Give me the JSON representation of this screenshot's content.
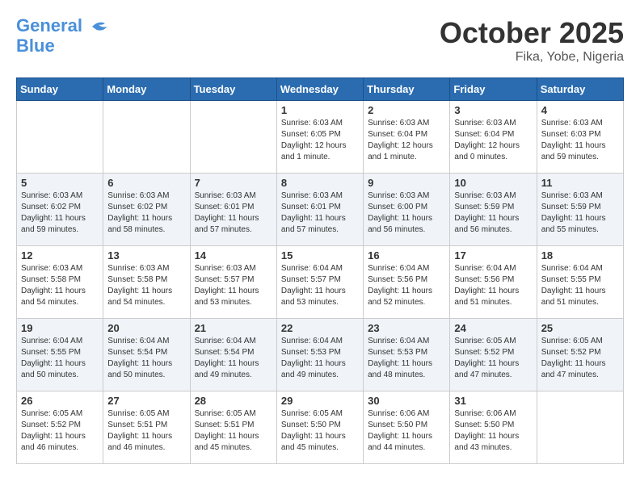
{
  "header": {
    "logo_line1": "General",
    "logo_line2": "Blue",
    "month": "October 2025",
    "location": "Fika, Yobe, Nigeria"
  },
  "days_of_week": [
    "Sunday",
    "Monday",
    "Tuesday",
    "Wednesday",
    "Thursday",
    "Friday",
    "Saturday"
  ],
  "weeks": [
    [
      {
        "num": "",
        "info": ""
      },
      {
        "num": "",
        "info": ""
      },
      {
        "num": "",
        "info": ""
      },
      {
        "num": "1",
        "info": "Sunrise: 6:03 AM\nSunset: 6:05 PM\nDaylight: 12 hours\nand 1 minute."
      },
      {
        "num": "2",
        "info": "Sunrise: 6:03 AM\nSunset: 6:04 PM\nDaylight: 12 hours\nand 1 minute."
      },
      {
        "num": "3",
        "info": "Sunrise: 6:03 AM\nSunset: 6:04 PM\nDaylight: 12 hours\nand 0 minutes."
      },
      {
        "num": "4",
        "info": "Sunrise: 6:03 AM\nSunset: 6:03 PM\nDaylight: 11 hours\nand 59 minutes."
      }
    ],
    [
      {
        "num": "5",
        "info": "Sunrise: 6:03 AM\nSunset: 6:02 PM\nDaylight: 11 hours\nand 59 minutes."
      },
      {
        "num": "6",
        "info": "Sunrise: 6:03 AM\nSunset: 6:02 PM\nDaylight: 11 hours\nand 58 minutes."
      },
      {
        "num": "7",
        "info": "Sunrise: 6:03 AM\nSunset: 6:01 PM\nDaylight: 11 hours\nand 57 minutes."
      },
      {
        "num": "8",
        "info": "Sunrise: 6:03 AM\nSunset: 6:01 PM\nDaylight: 11 hours\nand 57 minutes."
      },
      {
        "num": "9",
        "info": "Sunrise: 6:03 AM\nSunset: 6:00 PM\nDaylight: 11 hours\nand 56 minutes."
      },
      {
        "num": "10",
        "info": "Sunrise: 6:03 AM\nSunset: 5:59 PM\nDaylight: 11 hours\nand 56 minutes."
      },
      {
        "num": "11",
        "info": "Sunrise: 6:03 AM\nSunset: 5:59 PM\nDaylight: 11 hours\nand 55 minutes."
      }
    ],
    [
      {
        "num": "12",
        "info": "Sunrise: 6:03 AM\nSunset: 5:58 PM\nDaylight: 11 hours\nand 54 minutes."
      },
      {
        "num": "13",
        "info": "Sunrise: 6:03 AM\nSunset: 5:58 PM\nDaylight: 11 hours\nand 54 minutes."
      },
      {
        "num": "14",
        "info": "Sunrise: 6:03 AM\nSunset: 5:57 PM\nDaylight: 11 hours\nand 53 minutes."
      },
      {
        "num": "15",
        "info": "Sunrise: 6:04 AM\nSunset: 5:57 PM\nDaylight: 11 hours\nand 53 minutes."
      },
      {
        "num": "16",
        "info": "Sunrise: 6:04 AM\nSunset: 5:56 PM\nDaylight: 11 hours\nand 52 minutes."
      },
      {
        "num": "17",
        "info": "Sunrise: 6:04 AM\nSunset: 5:56 PM\nDaylight: 11 hours\nand 51 minutes."
      },
      {
        "num": "18",
        "info": "Sunrise: 6:04 AM\nSunset: 5:55 PM\nDaylight: 11 hours\nand 51 minutes."
      }
    ],
    [
      {
        "num": "19",
        "info": "Sunrise: 6:04 AM\nSunset: 5:55 PM\nDaylight: 11 hours\nand 50 minutes."
      },
      {
        "num": "20",
        "info": "Sunrise: 6:04 AM\nSunset: 5:54 PM\nDaylight: 11 hours\nand 50 minutes."
      },
      {
        "num": "21",
        "info": "Sunrise: 6:04 AM\nSunset: 5:54 PM\nDaylight: 11 hours\nand 49 minutes."
      },
      {
        "num": "22",
        "info": "Sunrise: 6:04 AM\nSunset: 5:53 PM\nDaylight: 11 hours\nand 49 minutes."
      },
      {
        "num": "23",
        "info": "Sunrise: 6:04 AM\nSunset: 5:53 PM\nDaylight: 11 hours\nand 48 minutes."
      },
      {
        "num": "24",
        "info": "Sunrise: 6:05 AM\nSunset: 5:52 PM\nDaylight: 11 hours\nand 47 minutes."
      },
      {
        "num": "25",
        "info": "Sunrise: 6:05 AM\nSunset: 5:52 PM\nDaylight: 11 hours\nand 47 minutes."
      }
    ],
    [
      {
        "num": "26",
        "info": "Sunrise: 6:05 AM\nSunset: 5:52 PM\nDaylight: 11 hours\nand 46 minutes."
      },
      {
        "num": "27",
        "info": "Sunrise: 6:05 AM\nSunset: 5:51 PM\nDaylight: 11 hours\nand 46 minutes."
      },
      {
        "num": "28",
        "info": "Sunrise: 6:05 AM\nSunset: 5:51 PM\nDaylight: 11 hours\nand 45 minutes."
      },
      {
        "num": "29",
        "info": "Sunrise: 6:05 AM\nSunset: 5:50 PM\nDaylight: 11 hours\nand 45 minutes."
      },
      {
        "num": "30",
        "info": "Sunrise: 6:06 AM\nSunset: 5:50 PM\nDaylight: 11 hours\nand 44 minutes."
      },
      {
        "num": "31",
        "info": "Sunrise: 6:06 AM\nSunset: 5:50 PM\nDaylight: 11 hours\nand 43 minutes."
      },
      {
        "num": "",
        "info": ""
      }
    ]
  ]
}
